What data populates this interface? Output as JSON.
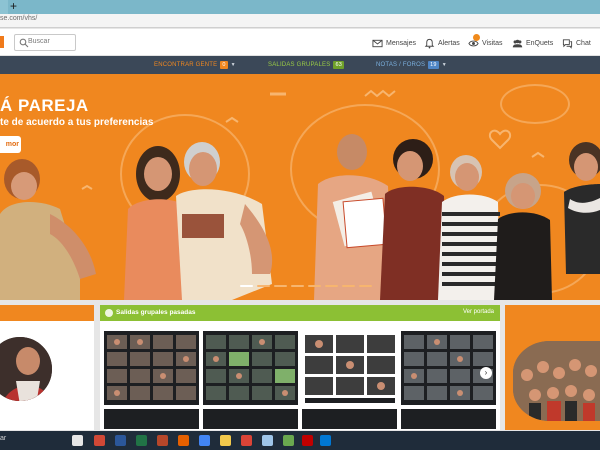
{
  "browser": {
    "new_tab": "+",
    "url": "se.com/vhs/"
  },
  "header": {
    "search_placeholder": "Buscar",
    "nav": [
      {
        "label": "Mensajes",
        "icon": "mail-icon"
      },
      {
        "label": "Alertas",
        "icon": "bell-icon"
      },
      {
        "label": "Visitas",
        "icon": "eye-icon"
      },
      {
        "label": "EnQuets",
        "icon": "people-icon"
      },
      {
        "label": "Chat",
        "icon": "chat-icon"
      }
    ]
  },
  "menu": [
    {
      "label": "ENCONTRAR GENTE",
      "count": "0",
      "color": "#f0871f",
      "badge": "#f0871f"
    },
    {
      "label": "SALIDAS GRUPALES",
      "count": "63",
      "color": "#9acb45",
      "badge": "#6fa12a"
    },
    {
      "label": "NOTAS / FOROS",
      "count": "19",
      "color": "#7bb0df",
      "badge": "#4f86c6"
    }
  ],
  "hero": {
    "title": "Á PAREJA",
    "subtitle": "te de acuerdo a tus preferencias",
    "button": "mor",
    "background": "#f0871f"
  },
  "section": {
    "title": "Salidas grupales pasadas",
    "link": "Ver portada",
    "accent": "#8cc034"
  },
  "taskbar": {
    "left_text": "ar"
  }
}
